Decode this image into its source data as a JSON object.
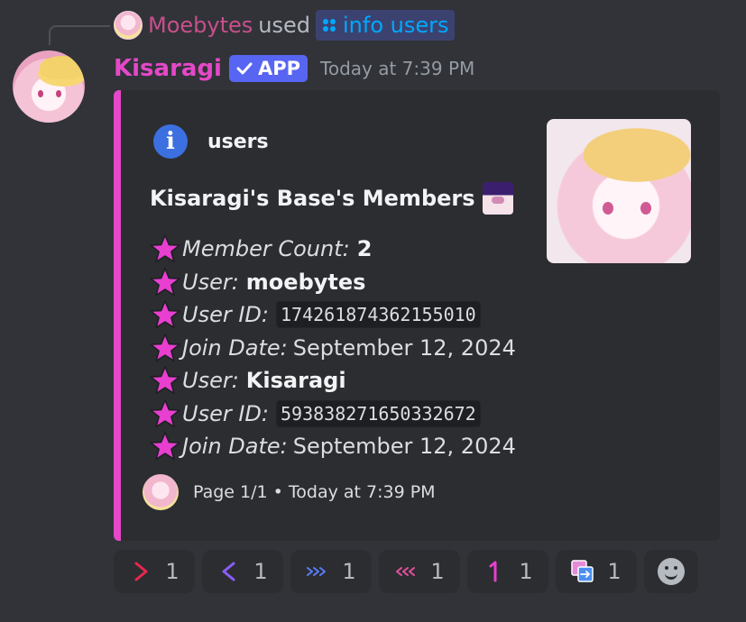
{
  "reply": {
    "user": "Moebytes",
    "used": "used",
    "command": "info users"
  },
  "message": {
    "username": "Kisaragi",
    "badge": "APP",
    "timestamp": "Today at 7:39 PM"
  },
  "embed": {
    "accent_color": "#e548c8",
    "author": "users",
    "title": "Kisaragi's Base's Members",
    "fields": [
      {
        "label": "Member Count:",
        "value": "2",
        "style": "bold"
      },
      {
        "label": "User:",
        "value": "moebytes",
        "style": "bold"
      },
      {
        "label": "User ID:",
        "value": "174261874362155010",
        "style": "code"
      },
      {
        "label": "Join Date:",
        "value": "September 12, 2024",
        "style": "plain"
      },
      {
        "label": "User:",
        "value": "Kisaragi",
        "style": "bold"
      },
      {
        "label": "User ID:",
        "value": "593838271650332672",
        "style": "code"
      },
      {
        "label": "Join Date:",
        "value": "September 12, 2024",
        "style": "plain"
      }
    ],
    "footer": "Page 1/1 • Today at 7:39 PM"
  },
  "reactions": [
    {
      "emoji": "right-chevron-red",
      "count": "1"
    },
    {
      "emoji": "left-chevron-purple",
      "count": "1"
    },
    {
      "emoji": "fast-forward-blue",
      "count": "1"
    },
    {
      "emoji": "rewind-pink",
      "count": "1"
    },
    {
      "emoji": "number-one-pink",
      "count": "1"
    },
    {
      "emoji": "repeat-square",
      "count": "1"
    }
  ],
  "colors": {
    "background": "#313338",
    "embed_background": "#2b2d31",
    "username": "#e548c8",
    "reply_user": "#c94f8c",
    "command": "#00a8fc",
    "app_badge": "#5865f2",
    "star": "#e83fd0"
  }
}
